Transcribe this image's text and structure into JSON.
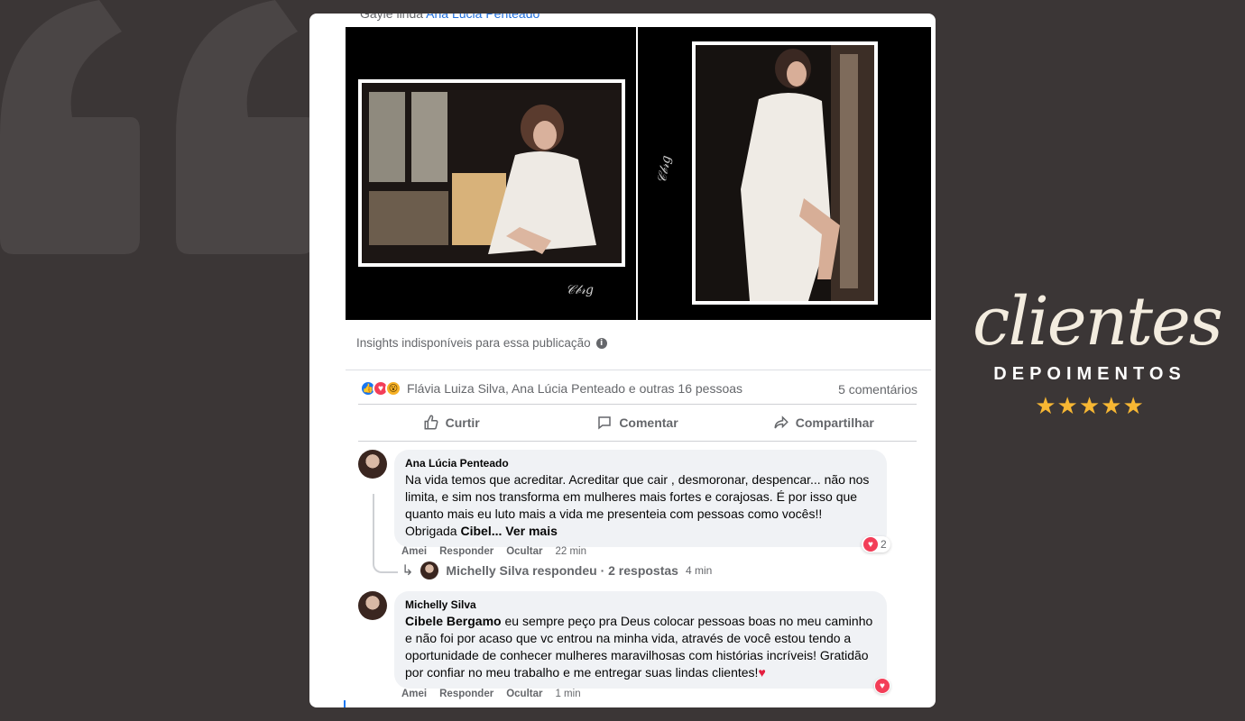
{
  "post": {
    "cut_prefix": "Gayle linda",
    "cut_link": "Ana Lúcia Penteado",
    "insights": "Insights indisponíveis para essa publicação",
    "reactions_text": "Flávia Luiza Silva, Ana Lúcia Penteado e outras 16 pessoas",
    "comments_count": "5 comentários",
    "actions": {
      "like": "Curtir",
      "comment": "Comentar",
      "share": "Compartilhar"
    }
  },
  "comments": [
    {
      "author": "Ana Lúcia Penteado",
      "text": "Na vida temos que acreditar. Acreditar que cair , desmoronar, despencar... não nos limita, e sim nos transforma em mulheres mais fortes e corajosas. É por isso que quanto mais eu luto mais a vida me presenteia com pessoas como vocês!! Obrigada",
      "mention": "Cibel...",
      "see_more": "Ver mais",
      "like": "Amei",
      "reply": "Responder",
      "hide": "Ocultar",
      "time": "22 min",
      "heart_count": "2",
      "reply_summary": "Michelly Silva respondeu · 2 respostas",
      "reply_time": "4 min"
    },
    {
      "author": "Michelly Silva",
      "mention": "Cibele Bergamo",
      "text": " eu sempre peço pra Deus colocar pessoas boas no meu caminho e não foi por acaso que vc entrou na minha vida, através de você estou tendo a oportunidade de conhecer mulheres maravilhosas com histórias incríveis! Gratidão por confiar no meu trabalho e me entregar suas lindas clientes!",
      "like": "Amei",
      "reply": "Responder",
      "hide": "Ocultar",
      "time": "1 min"
    }
  ],
  "brand": {
    "script": "clientes",
    "title": "DEPOIMENTOS",
    "stars": "★★★★★"
  },
  "icons": {
    "quote": "quote-mark-icon",
    "info": "info-icon",
    "like": "thumbs-up-icon",
    "comment": "comment-icon",
    "share": "share-icon",
    "heart": "heart-icon",
    "reply_arrow": "reply-arrow-icon"
  },
  "colors": {
    "background": "#3b3636",
    "facebook_blue": "#1877f2",
    "love_red": "#f33e58",
    "star_gold": "#f7b733"
  }
}
